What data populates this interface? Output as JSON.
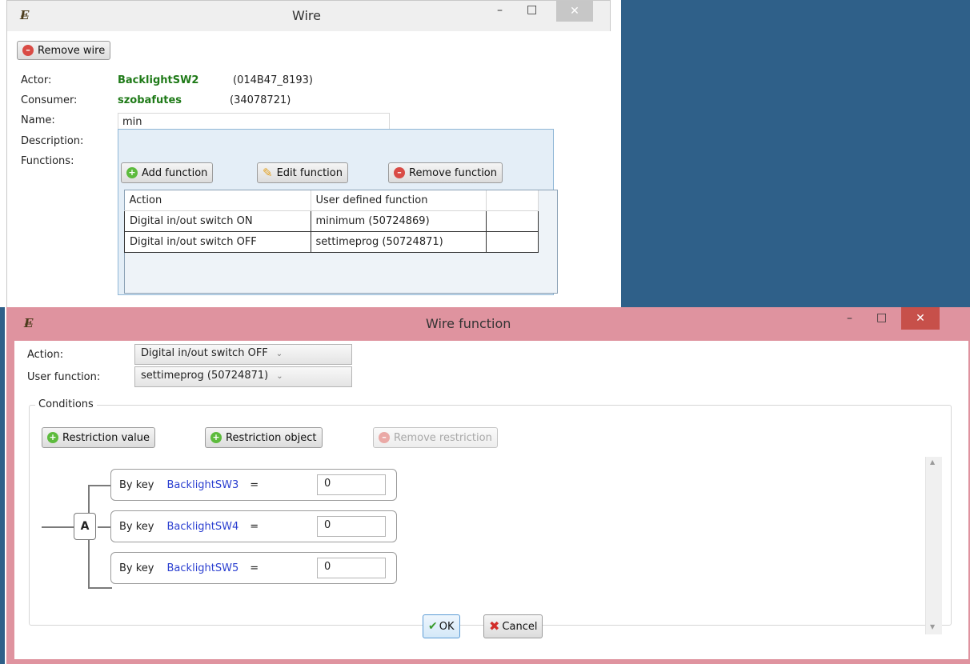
{
  "wire_window": {
    "title": "Wire",
    "remove_wire_label": "Remove wire",
    "actor_label": "Actor:",
    "actor_name": "BacklightSW2",
    "actor_id": "(014B47_8193)",
    "consumer_label": "Consumer:",
    "consumer_name": "szobafutes",
    "consumer_id": "(34078721)",
    "name_label": "Name:",
    "name_value": "min",
    "description_label": "Description:",
    "description_value": "",
    "functions_label": "Functions:",
    "add_function_label": "Add function",
    "edit_function_label": "Edit function",
    "remove_function_label": "Remove function",
    "table": {
      "columns": [
        "Action",
        "User defined function"
      ],
      "rows": [
        {
          "action": "Digital in/out switch ON",
          "function": "minimum (50724869)"
        },
        {
          "action": "Digital in/out switch OFF",
          "function": "settimeprog (50724871)"
        }
      ]
    }
  },
  "wire_function_dialog": {
    "title": "Wire function",
    "action_label": "Action:",
    "action_value": "Digital in/out switch OFF",
    "user_function_label": "User function:",
    "user_function_value": "settimeprog (50724871)",
    "conditions_label": "Conditions",
    "restriction_value_label": "Restriction value",
    "restriction_object_label": "Restriction object",
    "remove_restriction_label": "Remove restriction",
    "operator_node": "A",
    "conditions": [
      {
        "prefix": "By key",
        "key": "BacklightSW3",
        "op": "=",
        "value": "0"
      },
      {
        "prefix": "By key",
        "key": "BacklightSW4",
        "op": "=",
        "value": "0"
      },
      {
        "prefix": "By key",
        "key": "BacklightSW5",
        "op": "=",
        "value": "0"
      }
    ],
    "ok_label": "OK",
    "cancel_label": "Cancel"
  },
  "window_controls": {
    "minimize": "–",
    "maximize": "□",
    "close": "✕"
  },
  "colors": {
    "desktop": "#2f6089",
    "dialog_frame": "#df939f",
    "close_red": "#c7504a",
    "label_green": "#1f7a18",
    "key_blue": "#2b3fd0"
  }
}
